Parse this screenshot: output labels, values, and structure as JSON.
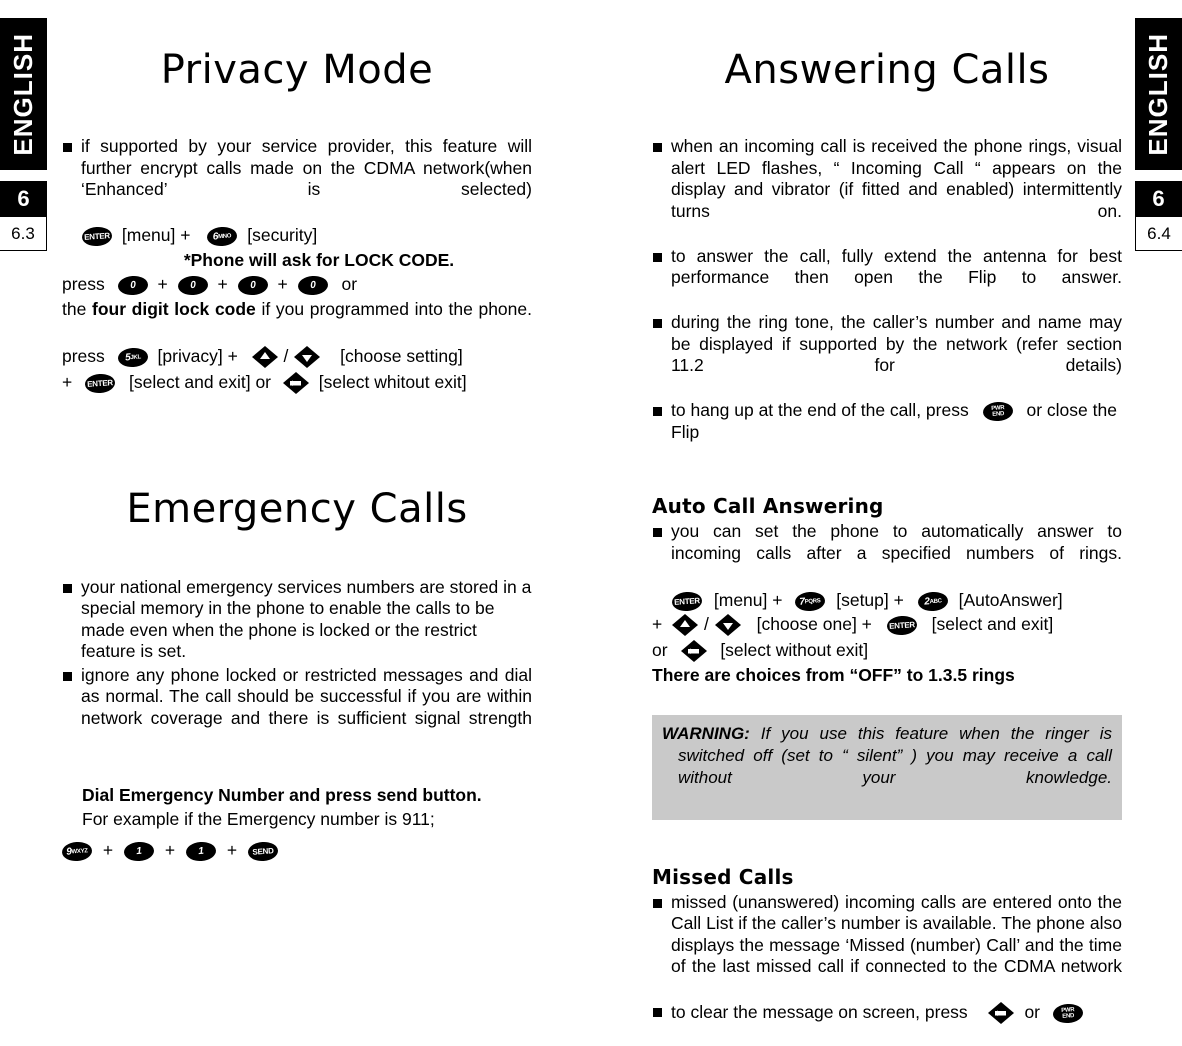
{
  "tabs": {
    "left": {
      "language": "ENGLISH",
      "chapter": "6",
      "section": "6.3"
    },
    "right": {
      "language": "ENGLISH",
      "chapter": "6",
      "section": "6.4"
    }
  },
  "left_column": {
    "privacy": {
      "title": "Privacy Mode",
      "bullet1": "if supported by your service provider, this feature will further encrypt calls made on the CDMA network(when ‘Enhanced’ is selected)",
      "step_menu_label": "[menu] +",
      "step_security_label": "[security]",
      "note_lock_code": "*Phone will ask for LOCK CODE.",
      "press_label": "press",
      "plus": "+",
      "or": "or",
      "four_digit_line_a": "the ",
      "four_digit_bold": "four digit lock code",
      "four_digit_line_b": " if you programmed into the phone.",
      "press2_label": "press",
      "privacy_label": "[privacy] +",
      "slash": "/",
      "choose_setting": "[choose setting]",
      "plus2": "+",
      "select_and_exit": "[select and exit] or",
      "select_without_exit": "[select whitout exit]"
    },
    "emergency": {
      "title": "Emergency Calls",
      "bullet1": "your national emergency services numbers are stored in a special memory in the phone to enable the calls to be made even when the phone is locked or the restrict feature is set.",
      "bullet2": "ignore any phone locked or restricted messages and dial as normal. The call should be successful if you are within network coverage and there is sufficient signal strength",
      "dial_heading": "Dial Emergency Number and press send button.",
      "example_line": "For example if the Emergency number is 911;",
      "plus": "+"
    }
  },
  "right_column": {
    "answering": {
      "title": "Answering Calls",
      "bullet1": "when an incoming call is received the phone rings, visual alert LED flashes, “ Incoming Call “  appears on the display and vibrator (if fitted and enabled) intermittently turns on.",
      "bullet2": "to answer the call, fully extend the antenna for best performance then open the Flip to answer.",
      "bullet3": "during the ring tone, the caller’s number and name may be displayed if supported by the network (refer section 11.2 for details)",
      "bullet4_a": "to hang up at the end of the call, press",
      "bullet4_b": "or close the Flip"
    },
    "auto_call": {
      "heading": "Auto Call Answering",
      "bullet1": "you can set the phone to automatically answer to incoming calls after a specified numbers of rings.",
      "menu_label": "[menu] +",
      "setup_label": "[setup] +",
      "autoanswer_label": "[AutoAnswer]",
      "plus": "+",
      "slash": "/",
      "choose_one": "[choose one] +",
      "select_and_exit": "[select and exit]",
      "or": "or",
      "select_without_exit": "[select without exit]",
      "choices_note": "There are choices from “OFF” to 1.3.5 rings"
    },
    "warning": {
      "label": "WARNING:",
      "text": "If you use this feature when the ringer is switched off (set to “ silent” ) you may receive a call without your knowledge."
    },
    "missed": {
      "heading": "Missed Calls",
      "bullet1": "missed (unanswered) incoming calls are entered onto the Call List if the caller’s number is available. The phone also displays the message ‘Missed (number) Call’ and the time of the last missed call if connected to the CDMA network",
      "bullet2_a": "to clear the message on screen, press",
      "bullet2_b": "or"
    }
  },
  "keys": {
    "enter": "ENTER",
    "six": "6 MNO",
    "five": "5 JKL",
    "seven": "7 PQRS",
    "two": "2 ABC",
    "zero": "0",
    "one": "1",
    "nine": "9 WXYZ",
    "send": "SEND",
    "pwr_end": "PWR END",
    "clear": "CLR",
    "nav_up": "navigate-up",
    "nav_down": "navigate-down"
  },
  "colors": {
    "ink": "#000000",
    "paper": "#ffffff",
    "warning_bg": "#c9c9c9"
  }
}
